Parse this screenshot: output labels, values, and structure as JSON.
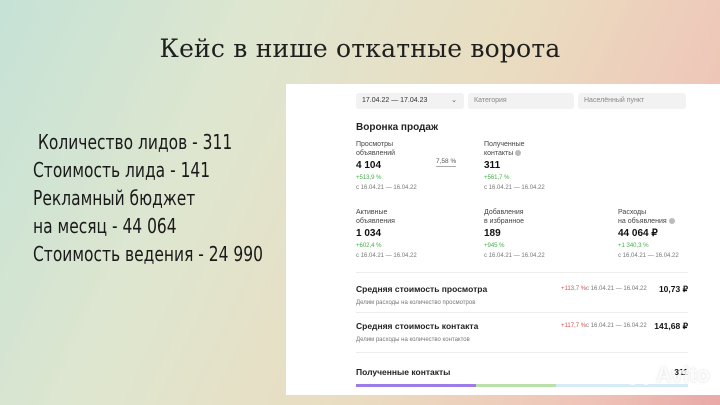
{
  "title": "Кейс в нише откатные ворота",
  "facts": [
    " Количество лидов - 311",
    "Стоимость лида - 141",
    "Рекламный бюджет",
    "на месяц - 44 064",
    "Стоимость ведения - 24 990"
  ],
  "filters": {
    "date": "17.04.22 — 17.04.23",
    "category": "Категория",
    "location": "Населённый пункт"
  },
  "funnel": {
    "title": "Воронка продаж",
    "conversion": "7,58 %",
    "metrics": {
      "views": {
        "label1": "Просмотры",
        "label2": "объявлений",
        "value": "4 104",
        "change": "+513,9 %",
        "period": "с 16.04.21 — 16.04.22"
      },
      "contacts": {
        "label1": "Полученные",
        "label2": "контакты",
        "value": "311",
        "change": "+561,7 %",
        "period": "с 16.04.21 — 16.04.22"
      },
      "active": {
        "label1": "Активные",
        "label2": "объявления",
        "value": "1 034",
        "change": "+602,4 %",
        "period": "с 16.04.21 — 16.04.22"
      },
      "favorites": {
        "label1": "Добавления",
        "label2": "в избранное",
        "value": "189",
        "change": "+945 %",
        "period": "с 16.04.21 — 16.04.22"
      },
      "expenses": {
        "label1": "Расходы",
        "label2": "на объявления",
        "value": "44 064 ₽",
        "change": "+1 340,3 %",
        "period": "с 16.04.21 — 16.04.22"
      }
    }
  },
  "cost_view": {
    "title": "Средняя стоимость просмотра",
    "sub": "Делим расходы на количество просмотров",
    "change": "+113,7 %",
    "period": "с 16.04.21 — 16.04.22",
    "value": "10,73 ₽"
  },
  "cost_contact": {
    "title": "Средняя стоимость контакта",
    "sub": "Делим расходы на количество контактов",
    "change": "+117,7 %",
    "period": "с 16.04.21 — 16.04.22",
    "value": "141,68 ₽"
  },
  "received": {
    "title": "Полученные контакты",
    "value": "311"
  },
  "watermark": "Avito",
  "colors": {
    "positive": "#46b04a",
    "negative": "#e05050"
  }
}
